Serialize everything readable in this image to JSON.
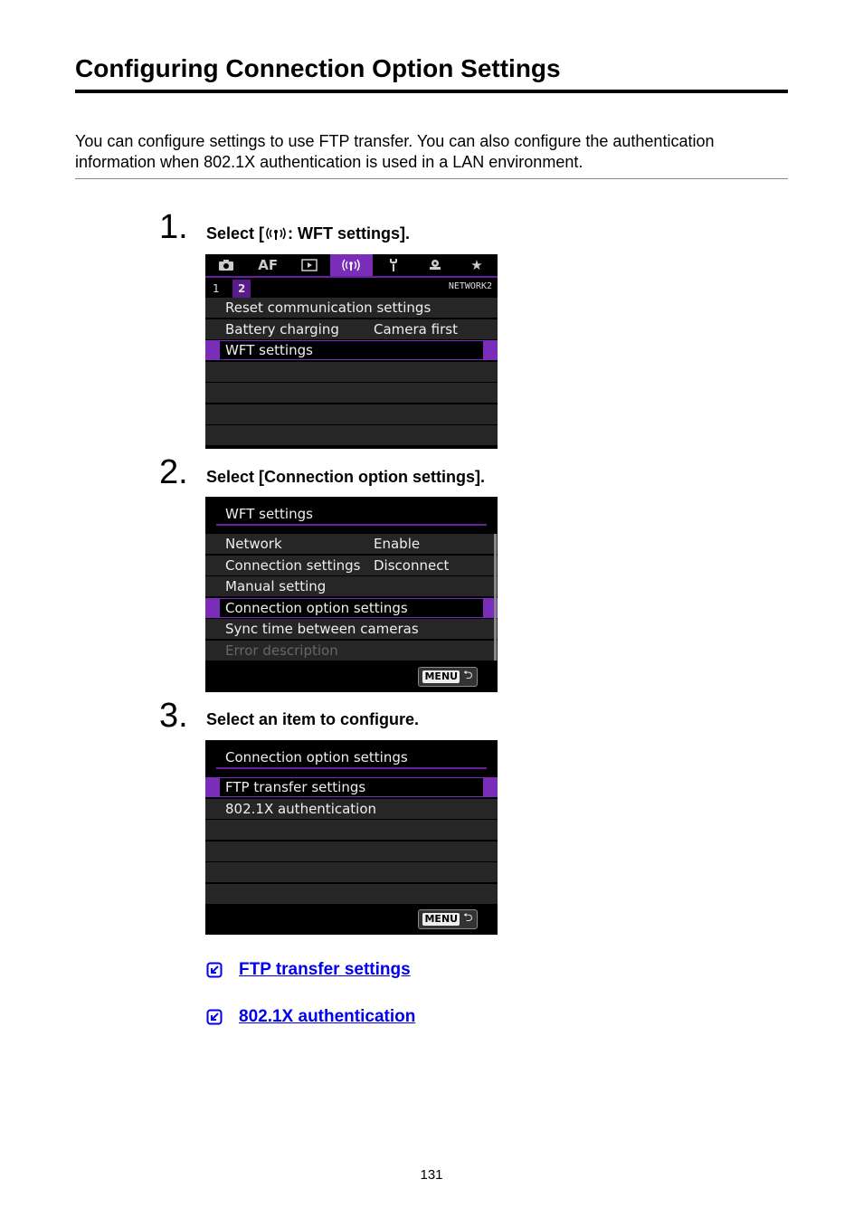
{
  "page": {
    "title": "Configuring Connection Option Settings",
    "intro": "You can configure settings to use FTP transfer. You can also configure the authentication information when 802.1X authentication is used in a LAN environment.",
    "page_number": "131"
  },
  "steps": [
    {
      "number": "1.",
      "text": "Select [((὎1)): WFT settings].",
      "text_display": "Select [((ı)): WFT settings]."
    },
    {
      "number": "2.",
      "text": "Select [Connection option settings]."
    },
    {
      "number": "3.",
      "text": "Select an item to configure."
    }
  ],
  "step1_text": "Select [⁽⁽ᵠ⁾⁾: WFT settings].",
  "screen1": {
    "tabs": [
      {
        "icon": "camera-icon",
        "glyph": "📷"
      },
      {
        "label": "AF"
      },
      {
        "icon": "play-icon",
        "glyph": "▶"
      },
      {
        "icon": "wireless-icon",
        "glyph": "((ı))",
        "active": true
      },
      {
        "icon": "wrench-icon",
        "glyph": "🔧"
      },
      {
        "icon": "custom-icon",
        "glyph": "☗"
      },
      {
        "icon": "star-icon",
        "glyph": "★"
      }
    ],
    "subtabs": [
      "1",
      "2"
    ],
    "active_subtab": "2",
    "section_label": "NETWORK2",
    "rows": [
      {
        "label": "Reset communication settings",
        "value": ""
      },
      {
        "label": "Battery charging",
        "value": "Camera first"
      },
      {
        "label": "WFT settings",
        "value": "",
        "selected": true
      }
    ]
  },
  "screen2": {
    "header": "WFT settings",
    "rows": [
      {
        "label": "Network",
        "value": "Enable"
      },
      {
        "label": "Connection settings",
        "value": "Disconnect"
      },
      {
        "label": "Manual setting",
        "value": ""
      },
      {
        "label": "Connection option settings",
        "value": "",
        "selected": true
      },
      {
        "label": "Sync time between cameras",
        "value": ""
      },
      {
        "label": "Error description",
        "value": "",
        "disabled": true
      }
    ],
    "menu_button": "MENU",
    "back_glyph": "⮌"
  },
  "screen3": {
    "header": "Connection option settings",
    "rows": [
      {
        "label": "FTP transfer settings",
        "selected": true
      },
      {
        "label": "802.1X authentication"
      }
    ],
    "menu_button": "MENU",
    "back_glyph": "⮌"
  },
  "links": [
    {
      "label": "FTP transfer settings"
    },
    {
      "label": "802.1X authentication"
    }
  ],
  "colors": {
    "accent_purple": "#7a2db8",
    "link_blue": "#0000ee"
  }
}
